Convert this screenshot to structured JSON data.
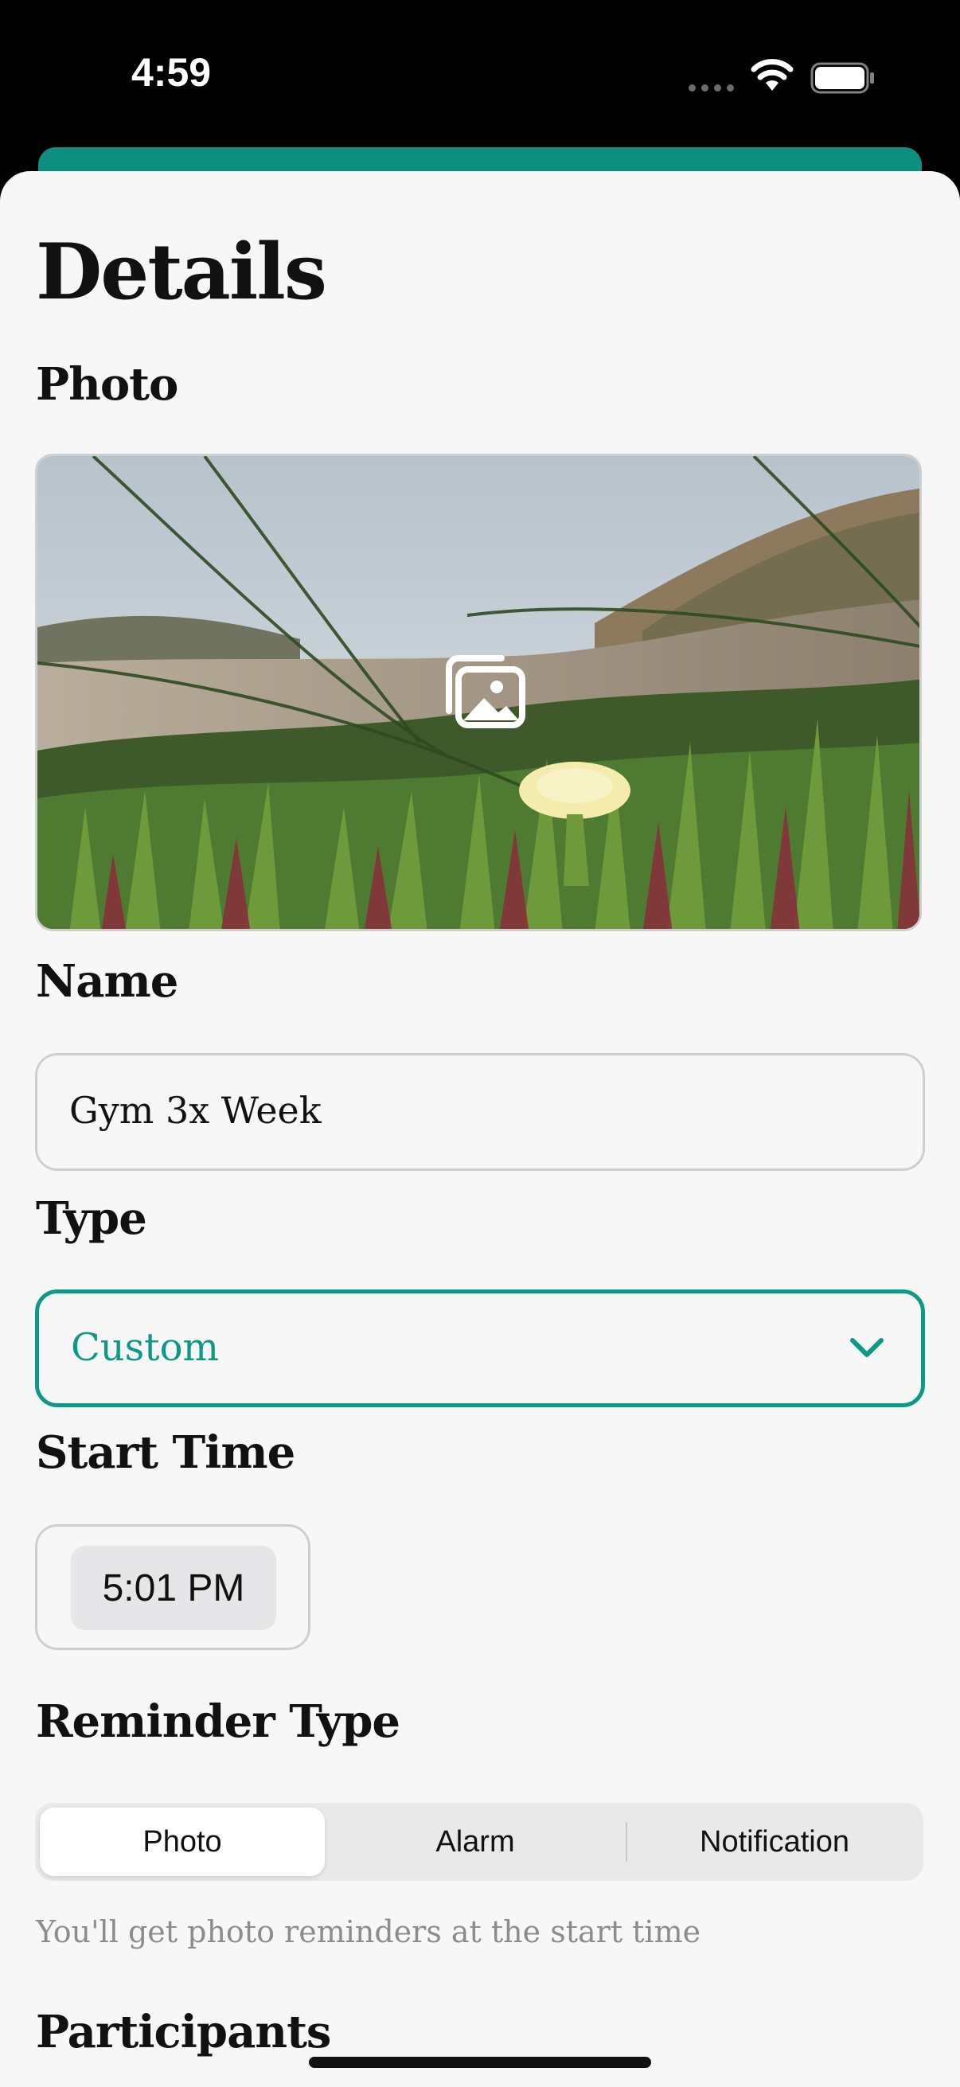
{
  "status_bar": {
    "time": "4:59"
  },
  "screen": {
    "title": "Details"
  },
  "photo": {
    "label": "Photo"
  },
  "name": {
    "label": "Name",
    "value": "Gym 3x Week"
  },
  "type": {
    "label": "Type",
    "value": "Custom"
  },
  "start_time": {
    "label": "Start Time",
    "value": "5:01 PM"
  },
  "reminder_type": {
    "label": "Reminder Type",
    "options": [
      "Photo",
      "Alarm",
      "Notification"
    ],
    "selected": "Photo",
    "helper": "You'll get photo reminders at the start time"
  },
  "participants": {
    "label": "Participants"
  },
  "colors": {
    "accent": "#0c9a86",
    "sheet_background": "#f7f7f7",
    "status_bar_background": "#000000"
  }
}
